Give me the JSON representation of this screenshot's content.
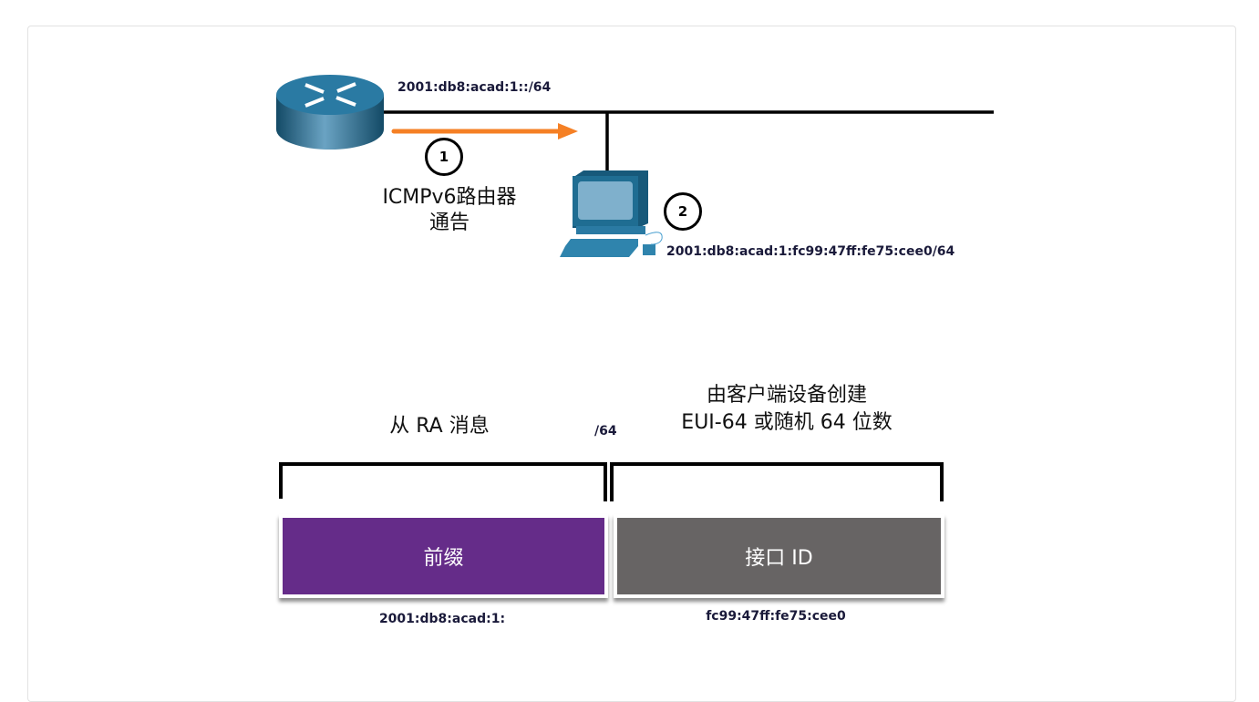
{
  "top": {
    "network_prefix": "2001:db8:acad:1::/64",
    "step1": "1",
    "step2": "2",
    "ra_line1": "ICMPv6路由器",
    "ra_line2": "通告",
    "host_address": "2001:db8:acad:1:fc99:47ff:fe75:cee0/64"
  },
  "bottom": {
    "left_caption": "从 RA 消息",
    "prefix_len": "/64",
    "right_caption_line1": "由客户端设备创建",
    "right_caption_line2": "EUI-64 或随机 64 位数",
    "prefix_label": "前缀",
    "interface_label": "接口 ID",
    "prefix_value": "2001:db8:acad:1:",
    "interface_value": "fc99:47ff:fe75:cee0"
  },
  "colors": {
    "prefix": "#652c89",
    "interface": "#676464",
    "arrow": "#f58025",
    "device": "#1f6d92"
  }
}
